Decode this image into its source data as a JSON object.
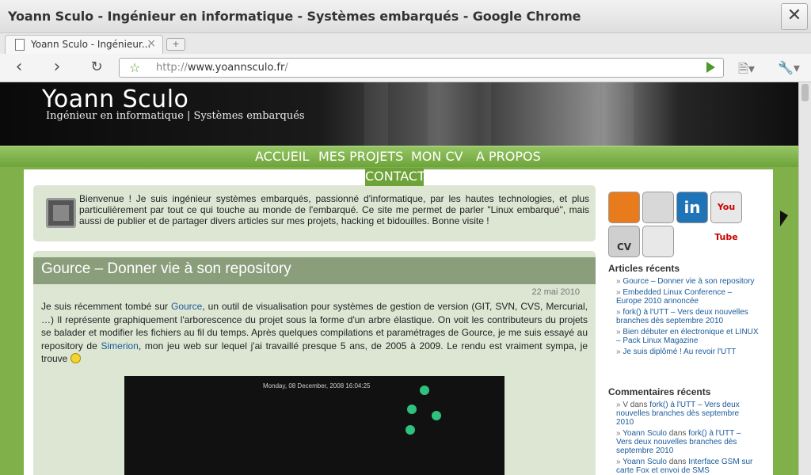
{
  "window": {
    "title": "Yoann Sculo - Ingénieur en informatique - Systèmes embarqués - Google Chrome",
    "close_glyph": "✕"
  },
  "tab": {
    "title": "Yoann Sculo - Ingénieur...",
    "close_glyph": "×"
  },
  "newtab_glyph": "+",
  "toolbar": {
    "back_glyph": "‹",
    "forward_glyph": "›",
    "reload_glyph": "↻",
    "url_prefix": "http://",
    "url_host": "www.yoannsculo.fr",
    "url_path": "/",
    "star_glyph": "☆",
    "page_glyph": "🗎▾",
    "wrench_glyph": "🔧▾"
  },
  "site": {
    "title": "Yoann Sculo",
    "description": "Ingénieur en informatique | Systèmes embarqués"
  },
  "nav": {
    "items": [
      "ACCUEIL",
      "MES PROJETS",
      "MON CV",
      "A PROPOS",
      "CONTACT"
    ]
  },
  "welcome": "Bienvenue ! Je suis ingénieur systèmes embarqués, passionné d'informatique, par les hautes technologies, et plus particulièrement par tout ce qui touche au monde de l'embarqué. Ce site me permet de parler \"Linux embarqué\", mais aussi de publier et de partager divers articles sur mes projets, hacking et bidouilles. Bonne visite !",
  "post": {
    "title": "Gource – Donner vie à son repository",
    "date": "22 mai 2010",
    "p1": "Je suis récemment tombé sur ",
    "link1": "Gource",
    "p2": ", un outil de visualisation pour systèmes de gestion de version (GIT, SVN, CVS, Mercurial, …) Il représente graphiquement l'arborescence du projet sous la forme d'un arbre élastique. On voit les contributeurs du projets se balader et modifier les fichiers au fil du temps. Après quelques compilations et paramétrages de Gource, je me suis essayé au repository de ",
    "link2": "Simerion",
    "p3": ", mon jeu web sur lequel j'ai travaillé presque 5 ans, de 2005 à 2009. Le rendu est vraiment sympa, je trouve ",
    "video_time": "Monday, 08 December, 2008 16:04:25"
  },
  "sidebar": {
    "social": {
      "linkedin": "in",
      "youtube": "You Tube",
      "cv": "CV"
    },
    "recent_articles_title": "Articles récents",
    "recent_articles": [
      "Gource – Donner vie à son repository",
      "Embedded Linux Conference – Europe 2010 annoncée",
      "fork() à l'UTT – Vers deux nouvelles branches dès septembre 2010",
      "Bien débuter en électronique et LINUX – Pack Linux Magazine",
      "Je suis diplômé ! Au revoir l'UTT"
    ],
    "recent_comments_title": "Commentaires récents",
    "recent_comments": [
      {
        "author": "V",
        "word": "dans",
        "post": "fork() à l'UTT – Vers deux nouvelles branches dès septembre 2010"
      },
      {
        "author": "Yoann Sculo",
        "word": "dans",
        "post": "fork() à l'UTT – Vers deux nouvelles branches dès septembre 2010"
      },
      {
        "author": "Yoann Sculo",
        "word": "dans",
        "post": "Interface GSM sur carte Fox et envoi de SMS"
      }
    ]
  }
}
